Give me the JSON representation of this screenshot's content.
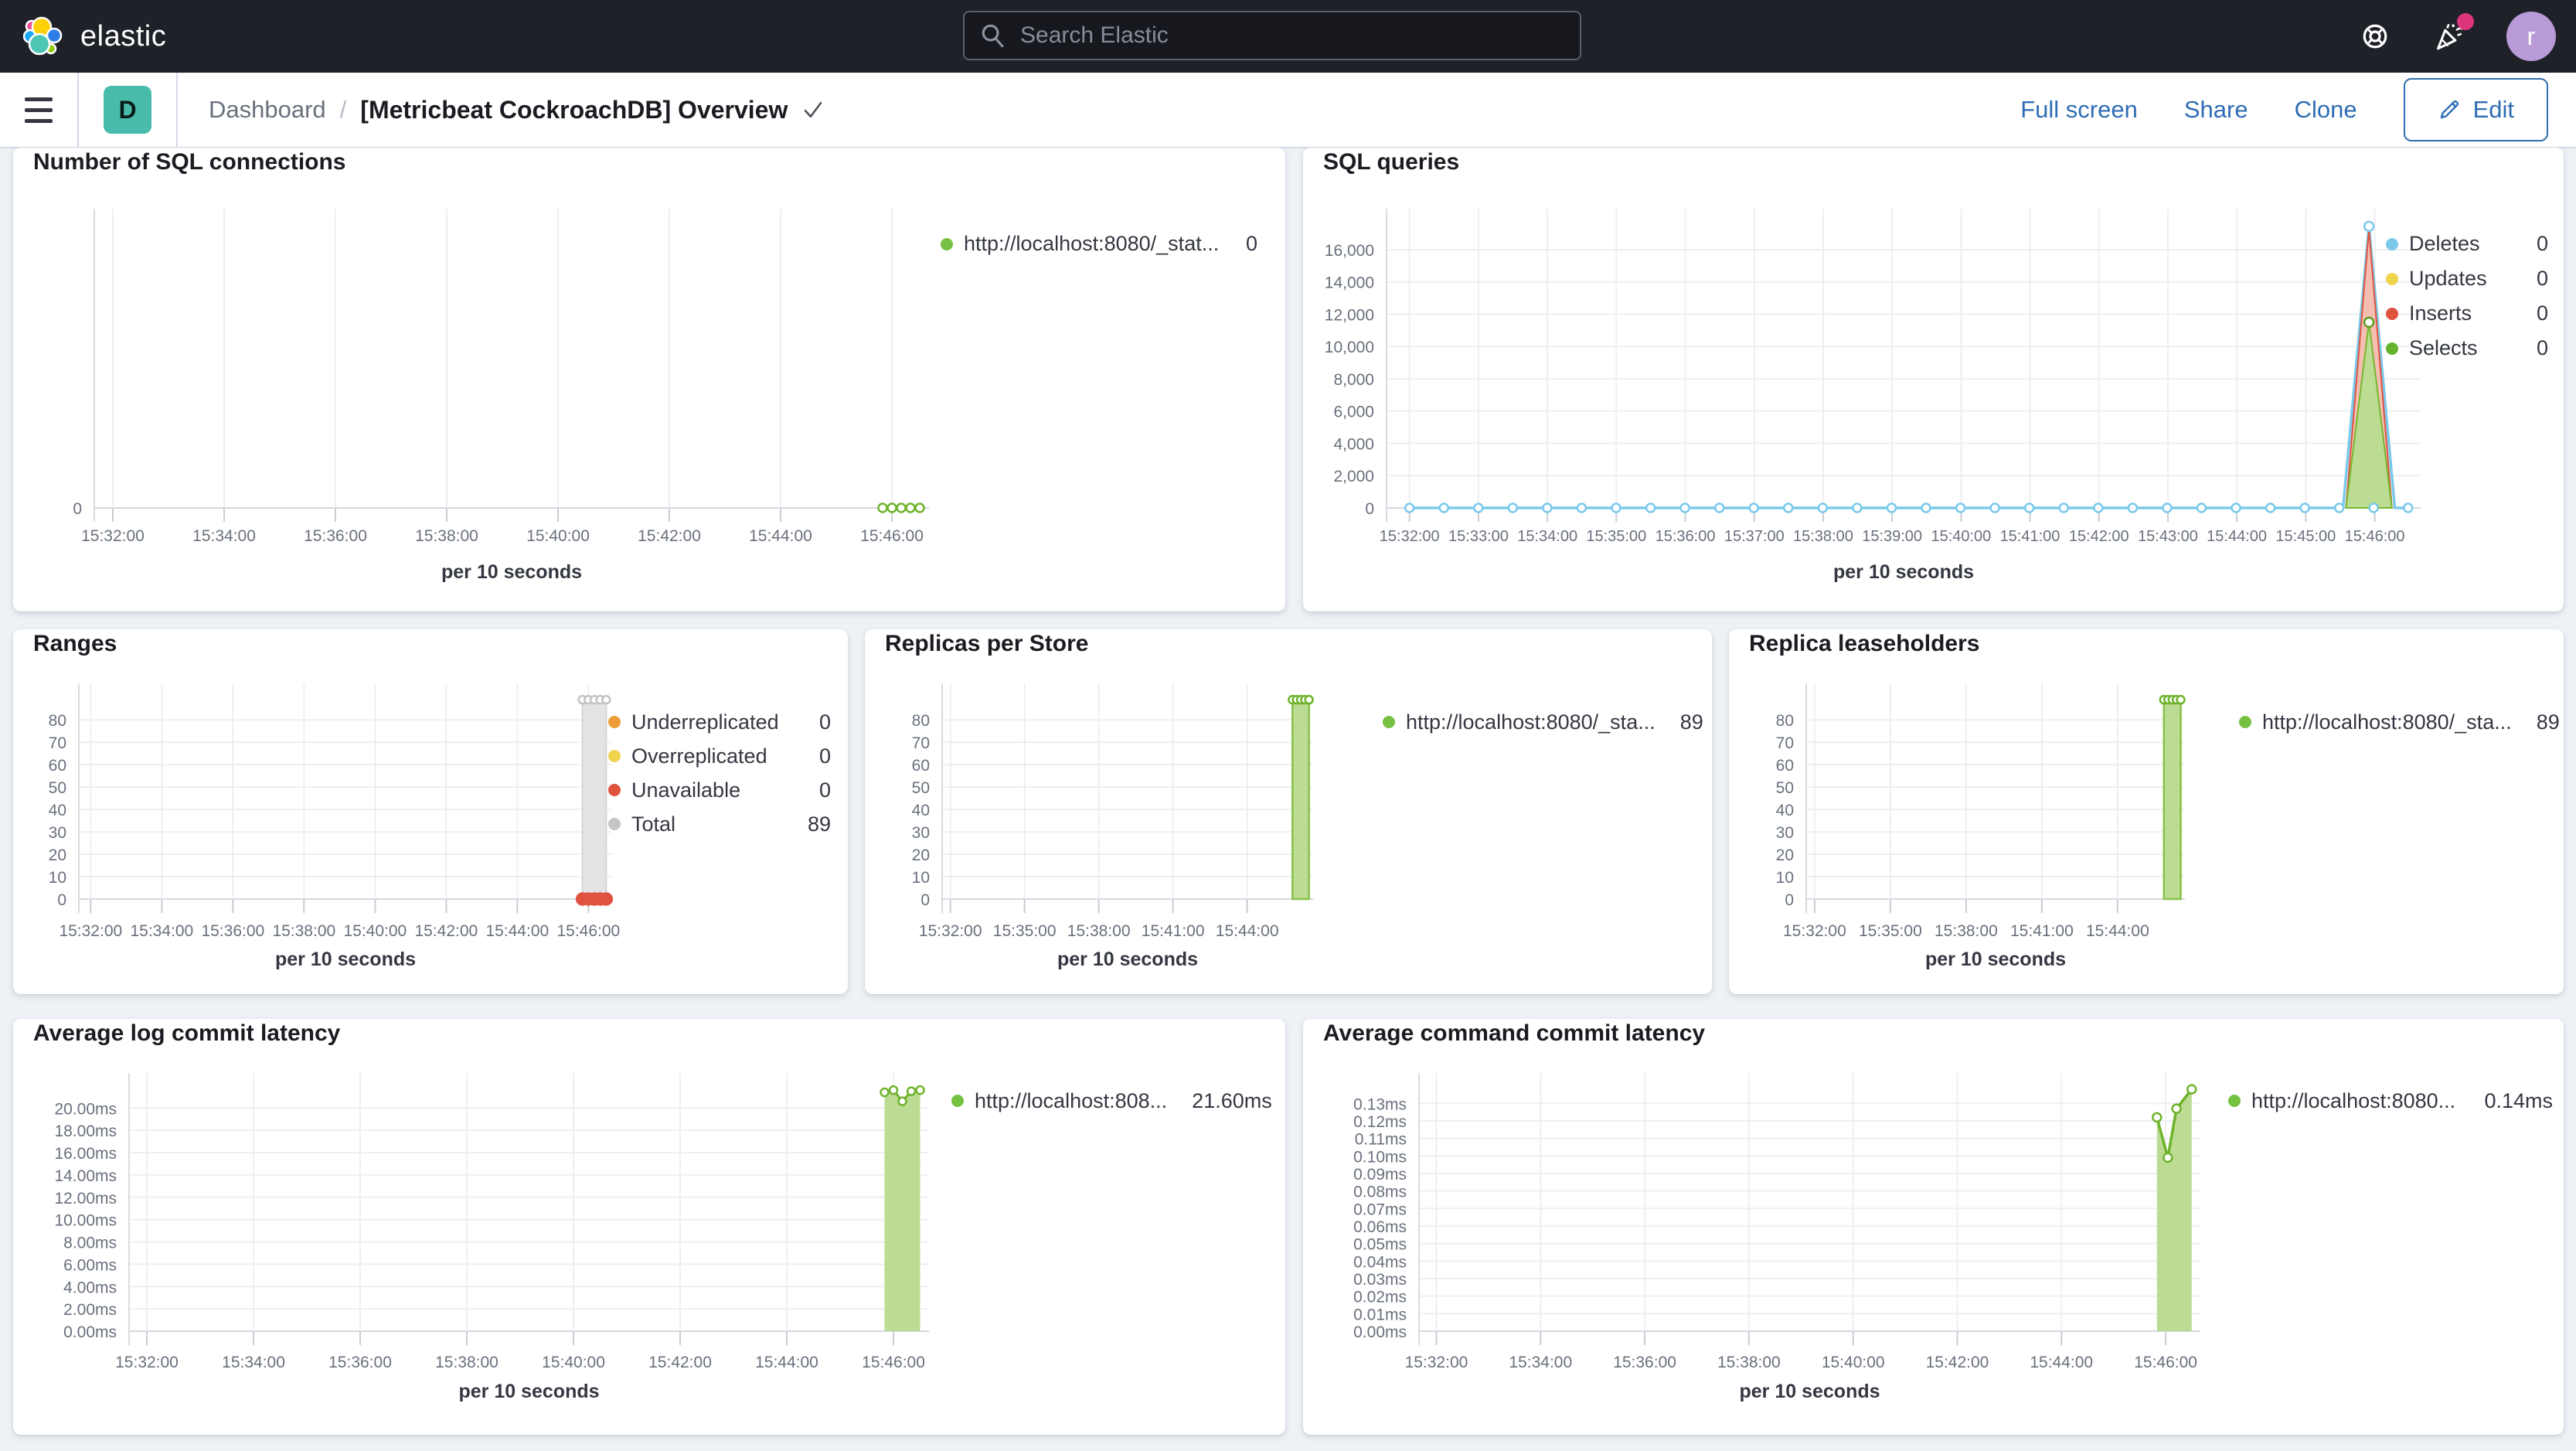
{
  "topbar": {
    "brand": "elastic",
    "search_placeholder": "Search Elastic",
    "avatar_initial": "r"
  },
  "navbar": {
    "space_initial": "D",
    "breadcrumb_root": "Dashboard",
    "breadcrumb_sep": "/",
    "breadcrumb_current": "[Metricbeat CockroachDB] Overview",
    "actions": [
      "Full screen",
      "Share",
      "Clone"
    ],
    "edit_label": "Edit"
  },
  "tick_sets": {
    "two_min": [
      [
        0.0222,
        "15:32:00"
      ],
      [
        0.1556,
        "15:34:00"
      ],
      [
        0.2889,
        "15:36:00"
      ],
      [
        0.4222,
        "15:38:00"
      ],
      [
        0.5556,
        "15:40:00"
      ],
      [
        0.6889,
        "15:42:00"
      ],
      [
        0.8222,
        "15:44:00"
      ],
      [
        0.9556,
        "15:46:00"
      ]
    ],
    "one_min": [
      [
        0.0222,
        "15:32:00"
      ],
      [
        0.0889,
        "15:33:00"
      ],
      [
        0.1556,
        "15:34:00"
      ],
      [
        0.2222,
        "15:35:00"
      ],
      [
        0.2889,
        "15:36:00"
      ],
      [
        0.3556,
        "15:37:00"
      ],
      [
        0.4222,
        "15:38:00"
      ],
      [
        0.4889,
        "15:39:00"
      ],
      [
        0.5556,
        "15:40:00"
      ],
      [
        0.6222,
        "15:41:00"
      ],
      [
        0.6889,
        "15:42:00"
      ],
      [
        0.7556,
        "15:43:00"
      ],
      [
        0.8222,
        "15:44:00"
      ],
      [
        0.8889,
        "15:45:00"
      ],
      [
        0.9556,
        "15:46:00"
      ]
    ],
    "three_min": [
      [
        0.0222,
        "15:32:00"
      ],
      [
        0.2222,
        "15:35:00"
      ],
      [
        0.4222,
        "15:38:00"
      ],
      [
        0.6222,
        "15:41:00"
      ],
      [
        0.8222,
        "15:44:00"
      ]
    ]
  },
  "chart_data": [
    {
      "id": "conn",
      "type": "line",
      "title": "Number of SQL connections",
      "xlabel": "per 10 seconds",
      "ymax": 1,
      "y_ticks": [
        [
          0,
          "0"
        ]
      ],
      "x_ticks": "two_min",
      "series": [
        {
          "kind": "line",
          "stroke": "#6eb32c",
          "sw": 3,
          "points": [
            [
              0.9444,
              0
            ],
            [
              0.9556,
              0
            ],
            [
              0.9667,
              0
            ],
            [
              0.9778,
              0
            ],
            [
              0.9889,
              0
            ]
          ]
        },
        {
          "kind": "markers",
          "r": 5.5,
          "stroke": "#6eb32c",
          "fill": "#ffffff",
          "points": [
            [
              0.9444,
              0
            ],
            [
              0.9556,
              0
            ],
            [
              0.9667,
              0
            ],
            [
              0.9778,
              0
            ],
            [
              0.9889,
              0
            ]
          ]
        }
      ],
      "legend": [
        {
          "color": "#77c142",
          "label": "http://localhost:8080/_stat...",
          "value": "0"
        }
      ]
    },
    {
      "id": "sql",
      "type": "area",
      "title": "SQL queries",
      "xlabel": "per 10 seconds",
      "ymax": 17580,
      "y_ticks": [
        [
          0,
          "0"
        ],
        [
          2000,
          "2,000"
        ],
        [
          4000,
          "4,000"
        ],
        [
          6000,
          "6,000"
        ],
        [
          8000,
          "8,000"
        ],
        [
          10000,
          "10,000"
        ],
        [
          12000,
          "12,000"
        ],
        [
          14000,
          "14,000"
        ],
        [
          16000,
          "16,000"
        ]
      ],
      "x_ticks": "one_min",
      "series": [
        {
          "kind": "line",
          "stroke": "#7ac9ea",
          "sw": 3.5,
          "points": [
            [
              0.0222,
              0
            ],
            [
              0.925,
              0
            ],
            [
              0.95,
              17450
            ],
            [
              0.975,
              0
            ],
            [
              0.9889,
              0
            ]
          ]
        },
        {
          "kind": "area",
          "fill": "#f5beb2",
          "stroke": "#e0533f",
          "sw": 2,
          "points": [
            [
              0.9278,
              0
            ],
            [
              0.95,
              17250
            ],
            [
              0.9722,
              0
            ]
          ]
        },
        {
          "kind": "area",
          "fill": "#bcdc94",
          "stroke": "#76b82e",
          "sw": 2,
          "points": [
            [
              0.9278,
              0
            ],
            [
              0.95,
              11500
            ],
            [
              0.9722,
              0
            ]
          ]
        },
        {
          "kind": "markers_range",
          "from": 0.0222,
          "to": 0.9889,
          "step": 0.0333,
          "v": 0,
          "r": 5.5,
          "stroke": "#7ac9ea",
          "fill": "#ffffff"
        },
        {
          "kind": "markers",
          "r": 6,
          "stroke": "#7ac9ea",
          "fill": "#ffffff",
          "points": [
            [
              0.95,
              17450
            ]
          ]
        },
        {
          "kind": "markers",
          "r": 6,
          "stroke": "#5da01f",
          "fill": "#ffffff",
          "points": [
            [
              0.95,
              11500
            ]
          ]
        }
      ],
      "legend": [
        {
          "color": "#7ac9ea",
          "label": "Deletes",
          "value": "0"
        },
        {
          "color": "#f0d44c",
          "label": "Updates",
          "value": "0"
        },
        {
          "color": "#e0533f",
          "label": "Inserts",
          "value": "0"
        },
        {
          "color": "#66b32b",
          "label": "Selects",
          "value": "0"
        }
      ]
    },
    {
      "id": "ranges",
      "type": "area",
      "title": "Ranges",
      "xlabel": "per 10 seconds",
      "ymax": 89.4,
      "y_ticks": [
        [
          0,
          "0"
        ],
        [
          10,
          "10"
        ],
        [
          20,
          "20"
        ],
        [
          30,
          "30"
        ],
        [
          40,
          "40"
        ],
        [
          50,
          "50"
        ],
        [
          60,
          "60"
        ],
        [
          70,
          "70"
        ],
        [
          80,
          "80"
        ]
      ],
      "x_ticks": "two_min",
      "series": [
        {
          "kind": "area",
          "fill": "#e4e4e6",
          "stroke": "#d5d5d7",
          "sw": 2,
          "points": [
            [
              0.9444,
              89
            ],
            [
              0.9889,
              89
            ]
          ]
        },
        {
          "kind": "markers",
          "r": 5,
          "stroke": "#c3c3c5",
          "fill": "#ffffff",
          "points": [
            [
              0.9444,
              89
            ],
            [
              0.9556,
              89
            ],
            [
              0.9667,
              89
            ],
            [
              0.9778,
              89
            ],
            [
              0.9889,
              89
            ]
          ]
        },
        {
          "kind": "markers",
          "r": 7.5,
          "stroke": "#e0533f",
          "fill": "#e0533f",
          "points": [
            [
              0.9444,
              0
            ],
            [
              0.9556,
              0
            ],
            [
              0.9667,
              0
            ],
            [
              0.9778,
              0
            ],
            [
              0.9889,
              0
            ]
          ]
        }
      ],
      "legend": [
        {
          "color": "#ee9c36",
          "label": "Underreplicated",
          "value": "0"
        },
        {
          "color": "#f0d44c",
          "label": "Overreplicated",
          "value": "0"
        },
        {
          "color": "#e0533f",
          "label": "Unavailable",
          "value": "0"
        },
        {
          "color": "#c6c6c8",
          "label": "Total",
          "value": "89"
        }
      ]
    },
    {
      "id": "replicas",
      "type": "area",
      "title": "Replicas per Store",
      "xlabel": "per 10 seconds",
      "ymax": 89.4,
      "y_ticks": [
        [
          0,
          "0"
        ],
        [
          10,
          "10"
        ],
        [
          20,
          "20"
        ],
        [
          30,
          "30"
        ],
        [
          40,
          "40"
        ],
        [
          50,
          "50"
        ],
        [
          60,
          "60"
        ],
        [
          70,
          "70"
        ],
        [
          80,
          "80"
        ]
      ],
      "x_ticks": "three_min",
      "series": [
        {
          "kind": "area",
          "fill": "#bcdc94",
          "stroke": "#87c14b",
          "sw": 2.5,
          "points": [
            [
              0.9444,
              89
            ],
            [
              0.9889,
              89
            ]
          ]
        },
        {
          "kind": "markers",
          "r": 5,
          "stroke": "#6eb32c",
          "fill": "#ffffff",
          "points": [
            [
              0.9444,
              89
            ],
            [
              0.9556,
              89
            ],
            [
              0.9667,
              89
            ],
            [
              0.9778,
              89
            ],
            [
              0.9889,
              89
            ]
          ]
        }
      ],
      "legend": [
        {
          "color": "#77c142",
          "label": "http://localhost:8080/_sta...",
          "value": "89"
        }
      ]
    },
    {
      "id": "lease",
      "type": "area",
      "title": "Replica leaseholders",
      "xlabel": "per 10 seconds",
      "ymax": 89.4,
      "y_ticks": [
        [
          0,
          "0"
        ],
        [
          10,
          "10"
        ],
        [
          20,
          "20"
        ],
        [
          30,
          "30"
        ],
        [
          40,
          "40"
        ],
        [
          50,
          "50"
        ],
        [
          60,
          "60"
        ],
        [
          70,
          "70"
        ],
        [
          80,
          "80"
        ]
      ],
      "x_ticks": "three_min",
      "series": [
        {
          "kind": "area",
          "fill": "#bcdc94",
          "stroke": "#87c14b",
          "sw": 2.5,
          "points": [
            [
              0.9444,
              89
            ],
            [
              0.9889,
              89
            ]
          ]
        },
        {
          "kind": "markers",
          "r": 5,
          "stroke": "#6eb32c",
          "fill": "#ffffff",
          "points": [
            [
              0.9444,
              89
            ],
            [
              0.9556,
              89
            ],
            [
              0.9667,
              89
            ],
            [
              0.9778,
              89
            ],
            [
              0.9889,
              89
            ]
          ]
        }
      ],
      "legend": [
        {
          "color": "#77c142",
          "label": "http://localhost:8080/_sta...",
          "value": "89"
        }
      ]
    },
    {
      "id": "loglat",
      "type": "area",
      "title": "Average log commit latency",
      "xlabel": "per 10 seconds",
      "ymax": 21.75,
      "y_ticks": [
        [
          0,
          "0.00ms"
        ],
        [
          2,
          "2.00ms"
        ],
        [
          4,
          "4.00ms"
        ],
        [
          6,
          "6.00ms"
        ],
        [
          8,
          "8.00ms"
        ],
        [
          10,
          "10.00ms"
        ],
        [
          12,
          "12.00ms"
        ],
        [
          14,
          "14.00ms"
        ],
        [
          16,
          "16.00ms"
        ],
        [
          18,
          "18.00ms"
        ],
        [
          20,
          "20.00ms"
        ]
      ],
      "x_ticks": "two_min",
      "series": [
        {
          "kind": "area",
          "fill": "#bcdc94",
          "sw": 0,
          "points": [
            [
              0.9444,
              21.4
            ],
            [
              0.9556,
              21.6
            ],
            [
              0.9667,
              20.6
            ],
            [
              0.9778,
              21.5
            ],
            [
              0.9889,
              21.6
            ]
          ]
        },
        {
          "kind": "line",
          "stroke": "#6eb32c",
          "sw": 3,
          "points": [
            [
              0.9444,
              21.4
            ],
            [
              0.9556,
              21.6
            ],
            [
              0.9667,
              20.6
            ],
            [
              0.9778,
              21.5
            ],
            [
              0.9889,
              21.6
            ]
          ]
        },
        {
          "kind": "markers",
          "r": 5,
          "stroke": "#6eb32c",
          "fill": "#ffffff",
          "points": [
            [
              0.9444,
              21.4
            ],
            [
              0.9556,
              21.6
            ],
            [
              0.9667,
              20.6
            ],
            [
              0.9778,
              21.5
            ],
            [
              0.9889,
              21.6
            ]
          ]
        }
      ],
      "legend": [
        {
          "color": "#77c142",
          "label": "http://localhost:808...",
          "value": "21.60ms"
        }
      ]
    },
    {
      "id": "cmdlat",
      "type": "area",
      "title": "Average command commit latency",
      "xlabel": "per 10 seconds",
      "ymax": 0.1385,
      "y_ticks": [
        [
          0,
          "0.00ms"
        ],
        [
          0.01,
          "0.01ms"
        ],
        [
          0.02,
          "0.02ms"
        ],
        [
          0.03,
          "0.03ms"
        ],
        [
          0.04,
          "0.04ms"
        ],
        [
          0.05,
          "0.05ms"
        ],
        [
          0.06,
          "0.06ms"
        ],
        [
          0.07,
          "0.07ms"
        ],
        [
          0.08,
          "0.08ms"
        ],
        [
          0.09,
          "0.09ms"
        ],
        [
          0.1,
          "0.10ms"
        ],
        [
          0.11,
          "0.11ms"
        ],
        [
          0.12,
          "0.12ms"
        ],
        [
          0.13,
          "0.13ms"
        ]
      ],
      "x_ticks": "two_min",
      "series": [
        {
          "kind": "area",
          "fill": "#bcdc94",
          "sw": 0,
          "points": [
            [
              0.9444,
              0.122
            ],
            [
              0.9583,
              0.099
            ],
            [
              0.9694,
              0.127
            ],
            [
              0.9889,
              0.138
            ]
          ]
        },
        {
          "kind": "line",
          "stroke": "#6eb32c",
          "sw": 3.5,
          "points": [
            [
              0.9444,
              0.122
            ],
            [
              0.9583,
              0.099
            ],
            [
              0.9694,
              0.127
            ],
            [
              0.9889,
              0.138
            ]
          ]
        },
        {
          "kind": "markers",
          "r": 5.5,
          "stroke": "#6eb32c",
          "fill": "#ffffff",
          "points": [
            [
              0.9444,
              0.122
            ],
            [
              0.9583,
              0.099
            ],
            [
              0.9694,
              0.127
            ],
            [
              0.9889,
              0.138
            ]
          ]
        }
      ],
      "legend": [
        {
          "color": "#77c142",
          "label": "http://localhost:8080...",
          "value": "0.14ms"
        }
      ]
    }
  ]
}
